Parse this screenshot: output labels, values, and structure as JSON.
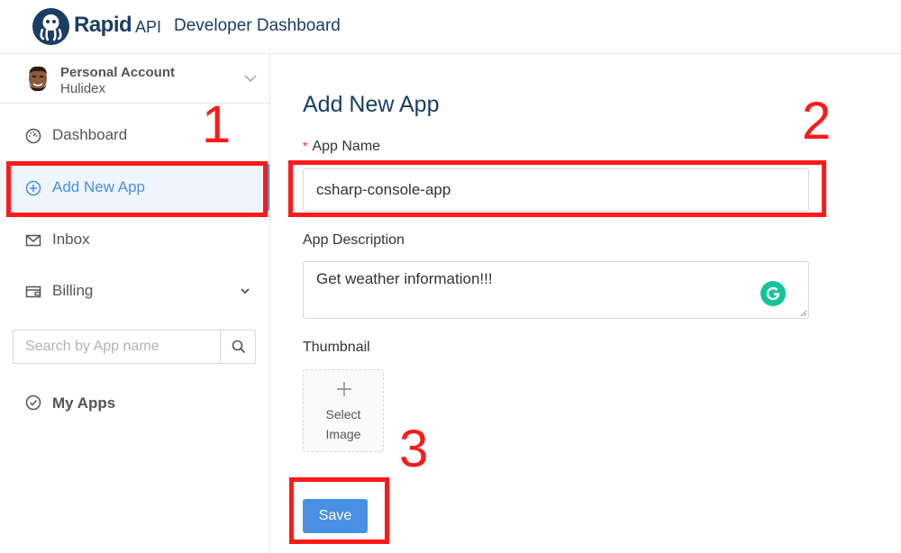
{
  "brand": {
    "name": "Rapid",
    "suffix": "API",
    "app_title": "Developer Dashboard"
  },
  "account": {
    "type": "Personal Account",
    "name": "Hulidex"
  },
  "sidebar": {
    "items": [
      {
        "label": "Dashboard",
        "icon": "dashboard-gauge-icon"
      },
      {
        "label": "Add New App",
        "icon": "plus-circle-icon",
        "active": true
      },
      {
        "label": "Inbox",
        "icon": "mail-icon"
      },
      {
        "label": "Billing",
        "icon": "wallet-icon"
      }
    ],
    "search_placeholder": "Search by App name",
    "my_apps_label": "My Apps"
  },
  "form": {
    "title": "Add New App",
    "app_name_required_mark": "*",
    "app_name_label": "App Name",
    "app_name_value": "csharp-console-app",
    "app_description_label": "App Description",
    "app_description_value": "Get weather information!!!",
    "thumbnail_label": "Thumbnail",
    "select_image_line1": "Select",
    "select_image_line2": "Image",
    "save_label": "Save"
  },
  "annotations": {
    "label_1": "1",
    "label_2": "2",
    "label_3": "3",
    "color": "#ff1a1a"
  },
  "colors": {
    "accent": "#4a90e2",
    "brand_navy": "#1b3e64",
    "grammarly_green": "#15c39a"
  }
}
